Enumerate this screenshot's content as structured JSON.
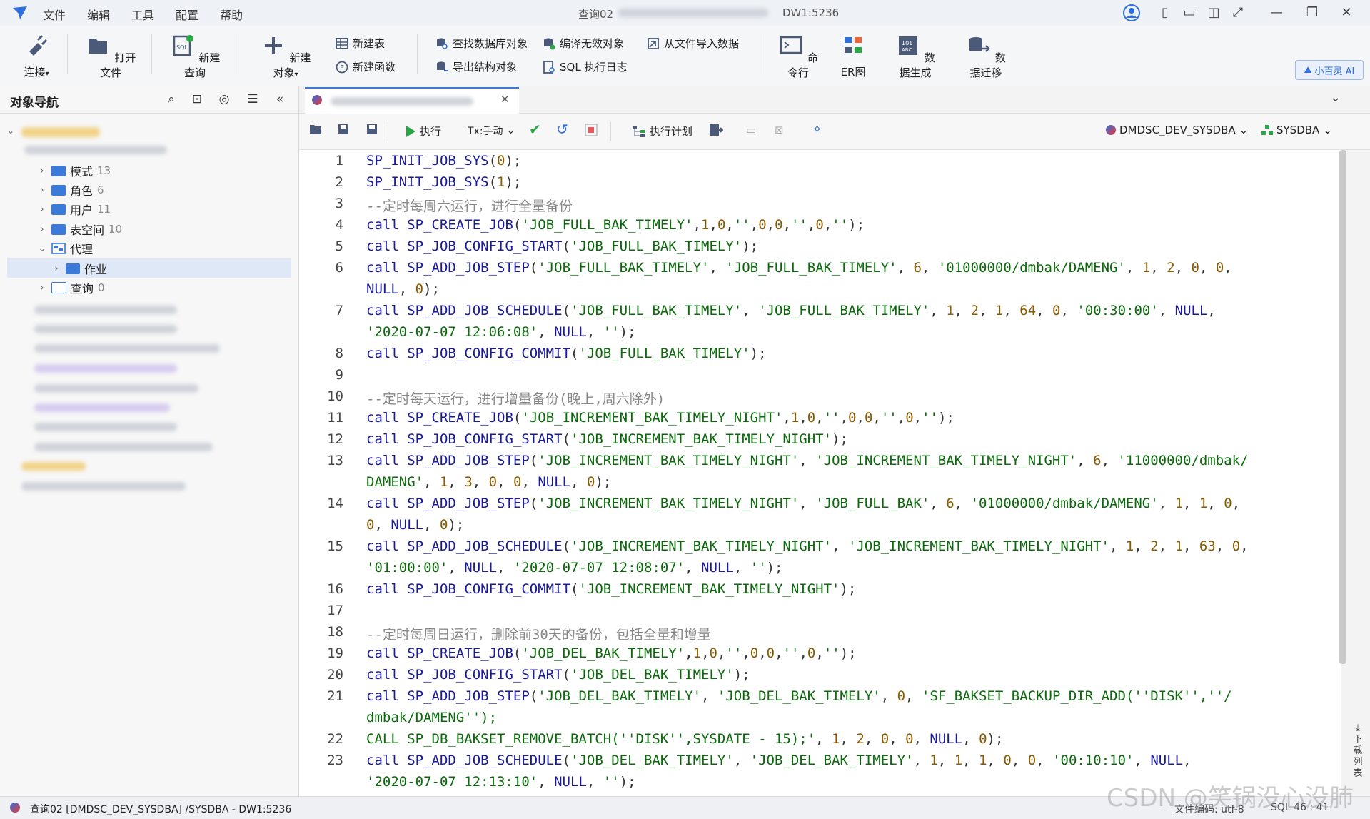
{
  "menu": [
    "文件",
    "编辑",
    "工具",
    "配置",
    "帮助"
  ],
  "window": {
    "title": "查询02",
    "title_suffix": "DW1:5236"
  },
  "ribbon": {
    "connect": "连接",
    "open_file": "打开文件",
    "new_query": "新建查询",
    "new_object": "新建对象",
    "new_table": "新建表",
    "new_function": "新建函数",
    "find_db_object": "查找数据库对象",
    "export_struct": "导出结构对象",
    "compile_invalid": "编译无效对象",
    "sql_log": "SQL 执行日志",
    "import_file": "从文件导入数据",
    "cmdline": "命令行",
    "er": "ER图",
    "datagen": "数据生成",
    "migrate": "数据迁移",
    "ai": "小百灵 AI"
  },
  "nav": {
    "title": "对象导航",
    "items": [
      {
        "label": "模式",
        "count": "13"
      },
      {
        "label": "角色",
        "count": "6"
      },
      {
        "label": "用户",
        "count": "11"
      },
      {
        "label": "表空间",
        "count": "10"
      },
      {
        "label": "代理",
        "count": ""
      },
      {
        "label": "作业",
        "count": ""
      },
      {
        "label": "查询",
        "count": "0"
      }
    ]
  },
  "toolbar": {
    "execute": "执行",
    "tx_mode": "Tx:手动",
    "exec_plan": "执行计划",
    "connection": "DMDSC_DEV_SYSDBA",
    "schema": "SYSDBA"
  },
  "code_lines": [
    {
      "n": "1",
      "segs": [
        [
          "fn",
          "SP_INIT_JOB_SYS"
        ],
        [
          "pn",
          "("
        ],
        [
          "num",
          "0"
        ],
        [
          "pn",
          ");"
        ]
      ]
    },
    {
      "n": "2",
      "segs": [
        [
          "fn",
          "SP_INIT_JOB_SYS"
        ],
        [
          "pn",
          "("
        ],
        [
          "num",
          "1"
        ],
        [
          "pn",
          ");"
        ]
      ]
    },
    {
      "n": "3",
      "segs": [
        [
          "cm",
          "--定时每周六运行，进行全量备份"
        ]
      ]
    },
    {
      "n": "4",
      "segs": [
        [
          "kw",
          "call "
        ],
        [
          "fn",
          "SP_CREATE_JOB"
        ],
        [
          "pn",
          "("
        ],
        [
          "str",
          "'JOB_FULL_BAK_TIMELY'"
        ],
        [
          "pn",
          ","
        ],
        [
          "num",
          "1"
        ],
        [
          "pn",
          ","
        ],
        [
          "num",
          "0"
        ],
        [
          "pn",
          ","
        ],
        [
          "str",
          "''"
        ],
        [
          "pn",
          ","
        ],
        [
          "num",
          "0"
        ],
        [
          "pn",
          ","
        ],
        [
          "num",
          "0"
        ],
        [
          "pn",
          ","
        ],
        [
          "str",
          "''"
        ],
        [
          "pn",
          ","
        ],
        [
          "num",
          "0"
        ],
        [
          "pn",
          ","
        ],
        [
          "str",
          "''"
        ],
        [
          "pn",
          ");"
        ]
      ]
    },
    {
      "n": "5",
      "segs": [
        [
          "kw",
          "call "
        ],
        [
          "fn",
          "SP_JOB_CONFIG_START"
        ],
        [
          "pn",
          "("
        ],
        [
          "str",
          "'JOB_FULL_BAK_TIMELY'"
        ],
        [
          "pn",
          ");"
        ]
      ]
    },
    {
      "n": "6",
      "segs": [
        [
          "kw",
          "call "
        ],
        [
          "fn",
          "SP_ADD_JOB_STEP"
        ],
        [
          "pn",
          "("
        ],
        [
          "str",
          "'JOB_FULL_BAK_TIMELY'"
        ],
        [
          "pn",
          ", "
        ],
        [
          "str",
          "'JOB_FULL_BAK_TIMELY'"
        ],
        [
          "pn",
          ", "
        ],
        [
          "num",
          "6"
        ],
        [
          "pn",
          ", "
        ],
        [
          "str",
          "'01000000/dmbak/DAMENG'"
        ],
        [
          "pn",
          ", "
        ],
        [
          "num",
          "1"
        ],
        [
          "pn",
          ", "
        ],
        [
          "num",
          "2"
        ],
        [
          "pn",
          ", "
        ],
        [
          "num",
          "0"
        ],
        [
          "pn",
          ", "
        ],
        [
          "num",
          "0"
        ],
        [
          "pn",
          ","
        ]
      ]
    },
    {
      "n": "",
      "segs": [
        [
          "kw",
          "NULL"
        ],
        [
          "pn",
          ", "
        ],
        [
          "num",
          "0"
        ],
        [
          "pn",
          ");"
        ]
      ]
    },
    {
      "n": "7",
      "segs": [
        [
          "kw",
          "call "
        ],
        [
          "fn",
          "SP_ADD_JOB_SCHEDULE"
        ],
        [
          "pn",
          "("
        ],
        [
          "str",
          "'JOB_FULL_BAK_TIMELY'"
        ],
        [
          "pn",
          ", "
        ],
        [
          "str",
          "'JOB_FULL_BAK_TIMELY'"
        ],
        [
          "pn",
          ", "
        ],
        [
          "num",
          "1"
        ],
        [
          "pn",
          ", "
        ],
        [
          "num",
          "2"
        ],
        [
          "pn",
          ", "
        ],
        [
          "num",
          "1"
        ],
        [
          "pn",
          ", "
        ],
        [
          "num",
          "64"
        ],
        [
          "pn",
          ", "
        ],
        [
          "num",
          "0"
        ],
        [
          "pn",
          ", "
        ],
        [
          "str",
          "'00:30:00'"
        ],
        [
          "pn",
          ", "
        ],
        [
          "kw",
          "NULL"
        ],
        [
          "pn",
          ","
        ]
      ]
    },
    {
      "n": "",
      "segs": [
        [
          "str",
          "'2020-07-07 12:06:08'"
        ],
        [
          "pn",
          ", "
        ],
        [
          "kw",
          "NULL"
        ],
        [
          "pn",
          ", "
        ],
        [
          "str",
          "''"
        ],
        [
          "pn",
          ");"
        ]
      ]
    },
    {
      "n": "8",
      "segs": [
        [
          "kw",
          "call "
        ],
        [
          "fn",
          "SP_JOB_CONFIG_COMMIT"
        ],
        [
          "pn",
          "("
        ],
        [
          "str",
          "'JOB_FULL_BAK_TIMELY'"
        ],
        [
          "pn",
          ");"
        ]
      ]
    },
    {
      "n": "9",
      "segs": []
    },
    {
      "n": "10",
      "segs": [
        [
          "cm",
          "--定时每天运行，进行增量备份(晚上,周六除外)"
        ]
      ]
    },
    {
      "n": "11",
      "segs": [
        [
          "kw",
          "call "
        ],
        [
          "fn",
          "SP_CREATE_JOB"
        ],
        [
          "pn",
          "("
        ],
        [
          "str",
          "'JOB_INCREMENT_BAK_TIMELY_NIGHT'"
        ],
        [
          "pn",
          ","
        ],
        [
          "num",
          "1"
        ],
        [
          "pn",
          ","
        ],
        [
          "num",
          "0"
        ],
        [
          "pn",
          ","
        ],
        [
          "str",
          "''"
        ],
        [
          "pn",
          ","
        ],
        [
          "num",
          "0"
        ],
        [
          "pn",
          ","
        ],
        [
          "num",
          "0"
        ],
        [
          "pn",
          ","
        ],
        [
          "str",
          "''"
        ],
        [
          "pn",
          ","
        ],
        [
          "num",
          "0"
        ],
        [
          "pn",
          ","
        ],
        [
          "str",
          "''"
        ],
        [
          "pn",
          ");"
        ]
      ]
    },
    {
      "n": "12",
      "segs": [
        [
          "kw",
          "call "
        ],
        [
          "fn",
          "SP_JOB_CONFIG_START"
        ],
        [
          "pn",
          "("
        ],
        [
          "str",
          "'JOB_INCREMENT_BAK_TIMELY_NIGHT'"
        ],
        [
          "pn",
          ");"
        ]
      ]
    },
    {
      "n": "13",
      "segs": [
        [
          "kw",
          "call "
        ],
        [
          "fn",
          "SP_ADD_JOB_STEP"
        ],
        [
          "pn",
          "("
        ],
        [
          "str",
          "'JOB_INCREMENT_BAK_TIMELY_NIGHT'"
        ],
        [
          "pn",
          ", "
        ],
        [
          "str",
          "'JOB_INCREMENT_BAK_TIMELY_NIGHT'"
        ],
        [
          "pn",
          ", "
        ],
        [
          "num",
          "6"
        ],
        [
          "pn",
          ", "
        ],
        [
          "str",
          "'11000000/dmbak/"
        ]
      ]
    },
    {
      "n": "",
      "segs": [
        [
          "str",
          "DAMENG'"
        ],
        [
          "pn",
          ", "
        ],
        [
          "num",
          "1"
        ],
        [
          "pn",
          ", "
        ],
        [
          "num",
          "3"
        ],
        [
          "pn",
          ", "
        ],
        [
          "num",
          "0"
        ],
        [
          "pn",
          ", "
        ],
        [
          "num",
          "0"
        ],
        [
          "pn",
          ", "
        ],
        [
          "kw",
          "NULL"
        ],
        [
          "pn",
          ", "
        ],
        [
          "num",
          "0"
        ],
        [
          "pn",
          ");"
        ]
      ]
    },
    {
      "n": "14",
      "segs": [
        [
          "kw",
          "call "
        ],
        [
          "fn",
          "SP_ADD_JOB_STEP"
        ],
        [
          "pn",
          "("
        ],
        [
          "str",
          "'JOB_INCREMENT_BAK_TIMELY_NIGHT'"
        ],
        [
          "pn",
          ", "
        ],
        [
          "str",
          "'JOB_FULL_BAK'"
        ],
        [
          "pn",
          ", "
        ],
        [
          "num",
          "6"
        ],
        [
          "pn",
          ", "
        ],
        [
          "str",
          "'01000000/dmbak/DAMENG'"
        ],
        [
          "pn",
          ", "
        ],
        [
          "num",
          "1"
        ],
        [
          "pn",
          ", "
        ],
        [
          "num",
          "1"
        ],
        [
          "pn",
          ", "
        ],
        [
          "num",
          "0"
        ],
        [
          "pn",
          ","
        ]
      ]
    },
    {
      "n": "",
      "segs": [
        [
          "num",
          "0"
        ],
        [
          "pn",
          ", "
        ],
        [
          "kw",
          "NULL"
        ],
        [
          "pn",
          ", "
        ],
        [
          "num",
          "0"
        ],
        [
          "pn",
          ");"
        ]
      ]
    },
    {
      "n": "15",
      "segs": [
        [
          "kw",
          "call "
        ],
        [
          "fn",
          "SP_ADD_JOB_SCHEDULE"
        ],
        [
          "pn",
          "("
        ],
        [
          "str",
          "'JOB_INCREMENT_BAK_TIMELY_NIGHT'"
        ],
        [
          "pn",
          ", "
        ],
        [
          "str",
          "'JOB_INCREMENT_BAK_TIMELY_NIGHT'"
        ],
        [
          "pn",
          ", "
        ],
        [
          "num",
          "1"
        ],
        [
          "pn",
          ", "
        ],
        [
          "num",
          "2"
        ],
        [
          "pn",
          ", "
        ],
        [
          "num",
          "1"
        ],
        [
          "pn",
          ", "
        ],
        [
          "num",
          "63"
        ],
        [
          "pn",
          ", "
        ],
        [
          "num",
          "0"
        ],
        [
          "pn",
          ","
        ]
      ]
    },
    {
      "n": "",
      "segs": [
        [
          "str",
          "'01:00:00'"
        ],
        [
          "pn",
          ", "
        ],
        [
          "kw",
          "NULL"
        ],
        [
          "pn",
          ", "
        ],
        [
          "str",
          "'2020-07-07 12:08:07'"
        ],
        [
          "pn",
          ", "
        ],
        [
          "kw",
          "NULL"
        ],
        [
          "pn",
          ", "
        ],
        [
          "str",
          "''"
        ],
        [
          "pn",
          ");"
        ]
      ]
    },
    {
      "n": "16",
      "segs": [
        [
          "kw",
          "call "
        ],
        [
          "fn",
          "SP_JOB_CONFIG_COMMIT"
        ],
        [
          "pn",
          "("
        ],
        [
          "str",
          "'JOB_INCREMENT_BAK_TIMELY_NIGHT'"
        ],
        [
          "pn",
          ");"
        ]
      ]
    },
    {
      "n": "17",
      "segs": []
    },
    {
      "n": "18",
      "segs": [
        [
          "cm",
          "--定时每周日运行，删除前30天的备份，包括全量和增量"
        ]
      ]
    },
    {
      "n": "19",
      "segs": [
        [
          "kw",
          "call "
        ],
        [
          "fn",
          "SP_CREATE_JOB"
        ],
        [
          "pn",
          "("
        ],
        [
          "str",
          "'JOB_DEL_BAK_TIMELY'"
        ],
        [
          "pn",
          ","
        ],
        [
          "num",
          "1"
        ],
        [
          "pn",
          ","
        ],
        [
          "num",
          "0"
        ],
        [
          "pn",
          ","
        ],
        [
          "str",
          "''"
        ],
        [
          "pn",
          ","
        ],
        [
          "num",
          "0"
        ],
        [
          "pn",
          ","
        ],
        [
          "num",
          "0"
        ],
        [
          "pn",
          ","
        ],
        [
          "str",
          "''"
        ],
        [
          "pn",
          ","
        ],
        [
          "num",
          "0"
        ],
        [
          "pn",
          ","
        ],
        [
          "str",
          "''"
        ],
        [
          "pn",
          ");"
        ]
      ]
    },
    {
      "n": "20",
      "segs": [
        [
          "kw",
          "call "
        ],
        [
          "fn",
          "SP_JOB_CONFIG_START"
        ],
        [
          "pn",
          "("
        ],
        [
          "str",
          "'JOB_DEL_BAK_TIMELY'"
        ],
        [
          "pn",
          ");"
        ]
      ]
    },
    {
      "n": "21",
      "segs": [
        [
          "kw",
          "call "
        ],
        [
          "fn",
          "SP_ADD_JOB_STEP"
        ],
        [
          "pn",
          "("
        ],
        [
          "str",
          "'JOB_DEL_BAK_TIMELY'"
        ],
        [
          "pn",
          ", "
        ],
        [
          "str",
          "'JOB_DEL_BAK_TIMELY'"
        ],
        [
          "pn",
          ", "
        ],
        [
          "num",
          "0"
        ],
        [
          "pn",
          ", "
        ],
        [
          "str",
          "'SF_BAKSET_BACKUP_DIR_ADD(''DISK'',''/"
        ]
      ]
    },
    {
      "n": "",
      "segs": [
        [
          "str",
          "dmbak/DAMENG'');"
        ]
      ]
    },
    {
      "n": "22",
      "segs": [
        [
          "str",
          "CALL SP_DB_BAKSET_REMOVE_BATCH(''DISK'',SYSDATE - 15);'"
        ],
        [
          "pn",
          ", "
        ],
        [
          "num",
          "1"
        ],
        [
          "pn",
          ", "
        ],
        [
          "num",
          "2"
        ],
        [
          "pn",
          ", "
        ],
        [
          "num",
          "0"
        ],
        [
          "pn",
          ", "
        ],
        [
          "num",
          "0"
        ],
        [
          "pn",
          ", "
        ],
        [
          "kw",
          "NULL"
        ],
        [
          "pn",
          ", "
        ],
        [
          "num",
          "0"
        ],
        [
          "pn",
          ");"
        ]
      ]
    },
    {
      "n": "23",
      "segs": [
        [
          "kw",
          "call "
        ],
        [
          "fn",
          "SP_ADD_JOB_SCHEDULE"
        ],
        [
          "pn",
          "("
        ],
        [
          "str",
          "'JOB_DEL_BAK_TIMELY'"
        ],
        [
          "pn",
          ", "
        ],
        [
          "str",
          "'JOB_DEL_BAK_TIMELY'"
        ],
        [
          "pn",
          ", "
        ],
        [
          "num",
          "1"
        ],
        [
          "pn",
          ", "
        ],
        [
          "num",
          "1"
        ],
        [
          "pn",
          ", "
        ],
        [
          "num",
          "1"
        ],
        [
          "pn",
          ", "
        ],
        [
          "num",
          "0"
        ],
        [
          "pn",
          ", "
        ],
        [
          "num",
          "0"
        ],
        [
          "pn",
          ", "
        ],
        [
          "str",
          "'00:10:10'"
        ],
        [
          "pn",
          ", "
        ],
        [
          "kw",
          "NULL"
        ],
        [
          "pn",
          ","
        ]
      ]
    },
    {
      "n": "",
      "segs": [
        [
          "str",
          "'2020-07-07 12:13:10'"
        ],
        [
          "pn",
          ", "
        ],
        [
          "kw",
          "NULL"
        ],
        [
          "pn",
          ", "
        ],
        [
          "str",
          "''"
        ],
        [
          "pn",
          ");"
        ]
      ]
    }
  ],
  "side_download": "下载列表",
  "status": {
    "left": "查询02 [DMDSC_DEV_SYSDBA] /SYSDBA - DW1:5236",
    "encoding": "文件编码: utf-8",
    "position": "SQL 46 : 41"
  },
  "watermark": "CSDN @笑锅没心没肺"
}
